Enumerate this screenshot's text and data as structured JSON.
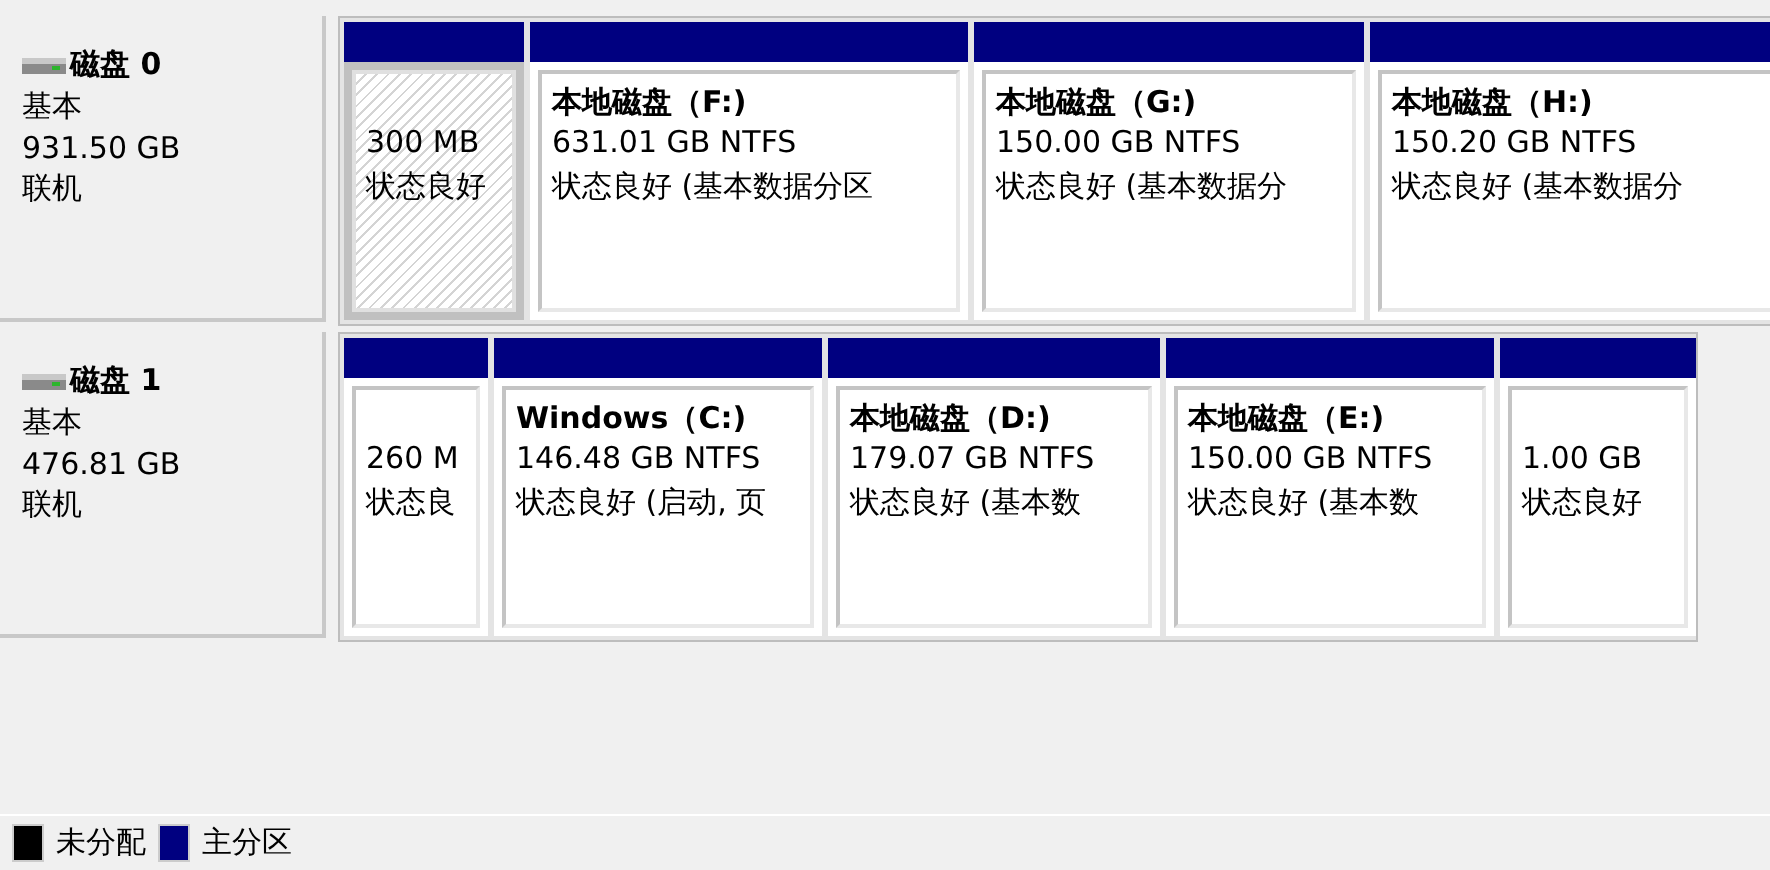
{
  "disks": [
    {
      "name": "磁盘 0",
      "type": "基本",
      "size": "931.50 GB",
      "status": "联机",
      "partitions": [
        {
          "selected": true,
          "size": "300 MB",
          "status": "状态良好"
        },
        {
          "selected": false,
          "title": "本地磁盘（F:)",
          "size": "631.01 GB NTFS",
          "status": "状态良好 (基本数据分区"
        },
        {
          "selected": false,
          "title": "本地磁盘（G:)",
          "size": "150.00 GB NTFS",
          "status": "状态良好 (基本数据分"
        },
        {
          "selected": false,
          "title": "本地磁盘（H:)",
          "size": "150.20 GB NTFS",
          "status": "状态良好 (基本数据分"
        }
      ]
    },
    {
      "name": "磁盘 1",
      "type": "基本",
      "size": "476.81 GB",
      "status": "联机",
      "partitions": [
        {
          "selected": false,
          "size": "260 M",
          "status": "状态良"
        },
        {
          "selected": false,
          "title": "Windows（C:)",
          "size": "146.48 GB NTFS",
          "status": "状态良好 (启动, 页"
        },
        {
          "selected": false,
          "title": "本地磁盘（D:)",
          "size": "179.07 GB NTFS",
          "status": "状态良好 (基本数"
        },
        {
          "selected": false,
          "title": "本地磁盘（E:)",
          "size": "150.00 GB NTFS",
          "status": "状态良好 (基本数"
        },
        {
          "selected": false,
          "size": "1.00 GB",
          "status": "状态良好"
        }
      ]
    }
  ],
  "legend": [
    {
      "label": "未分配",
      "color": "#000000"
    },
    {
      "label": "主分区",
      "color": "#000080"
    }
  ]
}
